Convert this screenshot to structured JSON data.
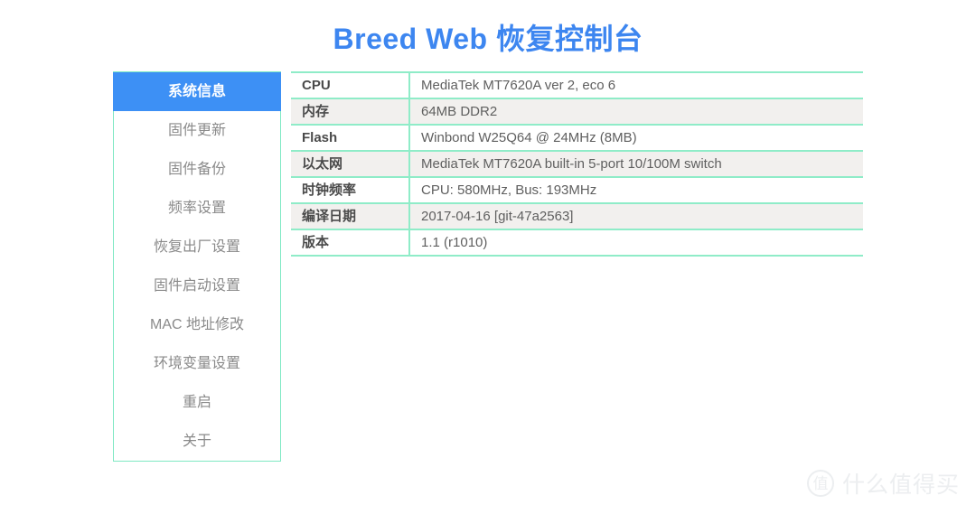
{
  "header": {
    "title": "Breed Web 恢复控制台",
    "title_color": "#3d86f0"
  },
  "sidebar": {
    "active_index": 0,
    "active_bg": "#3d90f5",
    "border_color": "#7fe8c3",
    "items": [
      {
        "label": "系统信息",
        "name": "sidebar-item-system-info"
      },
      {
        "label": "固件更新",
        "name": "sidebar-item-firmware-update"
      },
      {
        "label": "固件备份",
        "name": "sidebar-item-firmware-backup"
      },
      {
        "label": "频率设置",
        "name": "sidebar-item-frequency-settings"
      },
      {
        "label": "恢复出厂设置",
        "name": "sidebar-item-factory-reset"
      },
      {
        "label": "固件启动设置",
        "name": "sidebar-item-firmware-boot-settings"
      },
      {
        "label": "MAC 地址修改",
        "name": "sidebar-item-mac-address"
      },
      {
        "label": "环境变量设置",
        "name": "sidebar-item-env-variables"
      },
      {
        "label": "重启",
        "name": "sidebar-item-reboot"
      },
      {
        "label": "关于",
        "name": "sidebar-item-about"
      }
    ]
  },
  "system_info": {
    "border_color": "#8fecc8",
    "stripe_color": "#f2f0ee",
    "rows": [
      {
        "label": "CPU",
        "value": "MediaTek MT7620A ver 2, eco 6"
      },
      {
        "label": "内存",
        "value": "64MB DDR2"
      },
      {
        "label": "Flash",
        "value": "Winbond W25Q64 @ 24MHz (8MB)"
      },
      {
        "label": "以太网",
        "value": "MediaTek MT7620A built-in 5-port 10/100M switch"
      },
      {
        "label": "时钟频率",
        "value": "CPU: 580MHz, Bus: 193MHz"
      },
      {
        "label": "编译日期",
        "value": "2017-04-16 [git-47a2563]"
      },
      {
        "label": "版本",
        "value": "1.1 (r1010)"
      }
    ]
  },
  "watermark": {
    "badge": "值",
    "text": "什么值得买",
    "color": "#eceef0"
  }
}
